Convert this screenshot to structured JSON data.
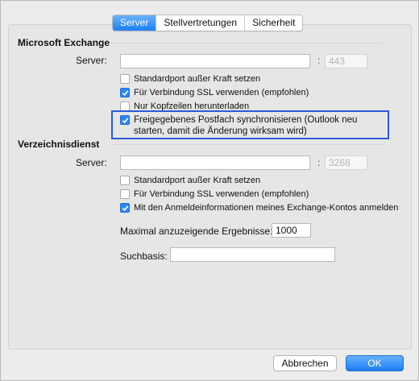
{
  "tabs": [
    "Server",
    "Stellvertretungen",
    "Sicherheit"
  ],
  "exchange": {
    "title": "Microsoft Exchange",
    "server_label": "Server:",
    "server_value": "",
    "port_value": "443",
    "options": [
      {
        "label": "Standardport außer Kraft setzen",
        "checked": false
      },
      {
        "label": "Für Verbindung SSL verwenden (empfohlen)",
        "checked": true
      },
      {
        "label": "Nur Kopfzeilen herunterladen",
        "checked": false
      },
      {
        "label": "Freigegebenes Postfach synchronisieren (Outlook neu starten, damit die Änderung wirksam wird)",
        "checked": true
      }
    ]
  },
  "directory": {
    "title": "Verzeichnisdienst",
    "server_label": "Server:",
    "server_value": "",
    "port_value": "3268",
    "options": [
      {
        "label": "Standardport außer Kraft setzen",
        "checked": false
      },
      {
        "label": "Für Verbindung SSL verwenden (empfohlen)",
        "checked": false
      },
      {
        "label": "Mit den Anmeldeinformationen meines Exchange-Kontos anmelden",
        "checked": true
      }
    ],
    "max_results_label": "Maximal anzuzeigende Ergebnisse:",
    "max_results_value": "1000",
    "search_base_label": "Suchbasis:",
    "search_base_value": ""
  },
  "buttons": {
    "cancel": "Abbrechen",
    "ok": "OK"
  },
  "colors": {
    "accent": "#1d7ff5",
    "highlight_border": "#2a5bd7"
  }
}
